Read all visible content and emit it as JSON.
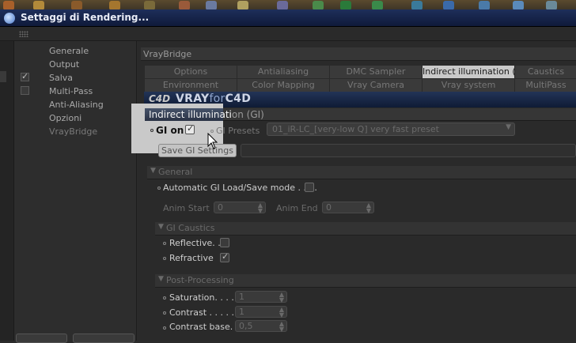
{
  "window": {
    "title": "Settaggi di Rendering..."
  },
  "nav": {
    "items": [
      {
        "label": "Generale",
        "checkbox": null,
        "enabled": true
      },
      {
        "label": "Output",
        "checkbox": null,
        "enabled": true
      },
      {
        "label": "Salva",
        "checkbox": true,
        "enabled": true
      },
      {
        "label": "Multi-Pass",
        "checkbox": false,
        "enabled": true
      },
      {
        "label": "Anti-Aliasing",
        "checkbox": null,
        "enabled": true
      },
      {
        "label": "Opzioni",
        "checkbox": null,
        "enabled": true
      },
      {
        "label": "VrayBridge",
        "checkbox": null,
        "enabled": false
      }
    ]
  },
  "panel": {
    "header": "VrayBridge",
    "tabs_row1": [
      "Options",
      "Antialiasing",
      "DMC Sampler",
      "Indirect illumination (GI)",
      "Caustics"
    ],
    "tabs_row2": [
      "Environment",
      "Color Mapping",
      "Vray Camera",
      "Vray system",
      "MultiPass"
    ],
    "active_tab": "Indirect illumination (GI)",
    "logo": {
      "main": "VRAY",
      "for": "for",
      "app": "C4D",
      "mark": "C4D"
    },
    "section_title": "Indirect illumination (GI)",
    "spotlight_title": "Indirect illuminati",
    "gi_on_label": "GI on",
    "gi_on_checked": true,
    "presets_label": "GI Presets",
    "presets_value": "01_iR-LC_[very-low Q] very fast preset",
    "save_button": "Save GI Settings",
    "general": {
      "header": "General",
      "auto_mode_label": "Automatic GI Load/Save mode . . . .",
      "auto_mode_checked": false,
      "anim_start_label": "Anim Start",
      "anim_start_value": "0",
      "anim_end_label": "Anim End",
      "anim_end_value": "0"
    },
    "caustics": {
      "header": "GI Caustics",
      "reflective_label": "Reflective. .",
      "reflective_checked": false,
      "refractive_label": "Refractive",
      "refractive_checked": true
    },
    "post": {
      "header": "Post-Processing",
      "saturation_label": "Saturation. . . . .",
      "saturation_value": "1",
      "contrast_label": "Contrast . . . . . .",
      "contrast_value": "1",
      "contrast_base_label": "Contrast base. . .",
      "contrast_base_value": "0,5"
    }
  },
  "colors": {
    "titlebar": "#1e2f5a",
    "background": "#2a2a2a",
    "spotlight": "#c9c9c9"
  }
}
